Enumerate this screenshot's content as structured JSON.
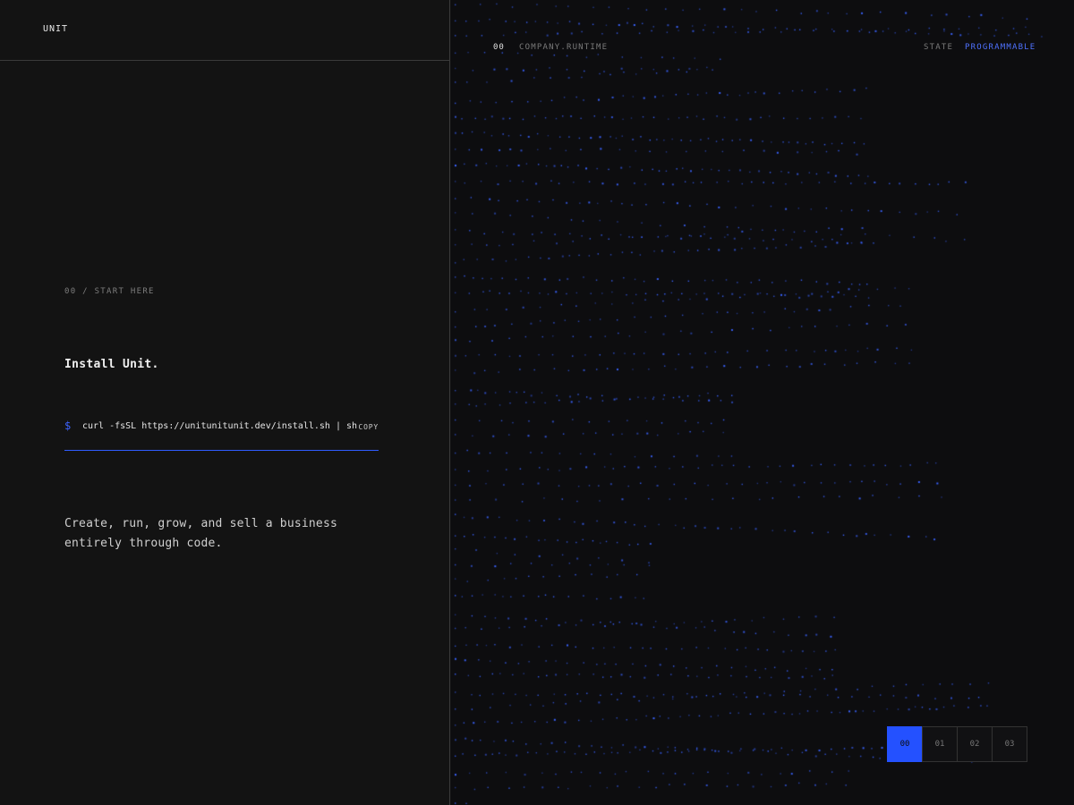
{
  "brand": "UNIT",
  "hero": {
    "eyebrow": "00 / START HERE",
    "headline": "Install Unit.",
    "command": {
      "prompt": "$",
      "text": "curl -fsSL https://unitunitunit.dev/install.sh | sh",
      "copy_label": "COPY"
    },
    "tagline": "Create, run, grow, and sell a business entirely through code."
  },
  "visual": {
    "index": "00",
    "label": "COMPANY.RUNTIME",
    "state_label": "STATE",
    "state_value": "PROGRAMMABLE",
    "pager": [
      "00",
      "01",
      "02",
      "03"
    ],
    "pager_active": "00"
  },
  "colors": {
    "accent": "#2451ff",
    "accent_text": "#4f72ff",
    "dot": "#3a63ff",
    "background": "#0d0d0f"
  }
}
